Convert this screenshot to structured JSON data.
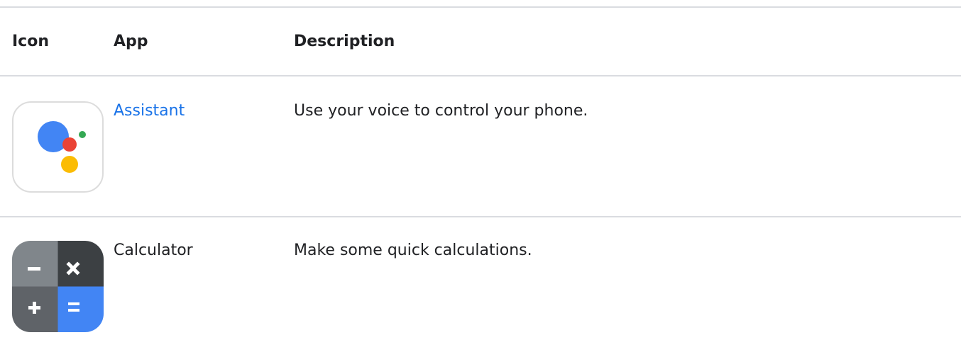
{
  "table": {
    "headers": {
      "icon": "Icon",
      "app": "App",
      "description": "Description"
    },
    "rows": [
      {
        "icon": "google-assistant-icon",
        "app": "Assistant",
        "app_is_link": true,
        "description": "Use your voice to control your phone."
      },
      {
        "icon": "calculator-icon",
        "app": "Calculator",
        "app_is_link": false,
        "description": "Make some quick calculations."
      }
    ]
  },
  "colors": {
    "link": "#1a73e8",
    "divider": "#dadce0",
    "text": "#202124",
    "assistant_blue": "#4285f4",
    "assistant_red": "#ea4335",
    "assistant_yellow": "#fbbc04",
    "assistant_green": "#34a853",
    "calc_gray": "#80868b",
    "calc_dark": "#3c4043",
    "calc_blue": "#4285f4"
  }
}
